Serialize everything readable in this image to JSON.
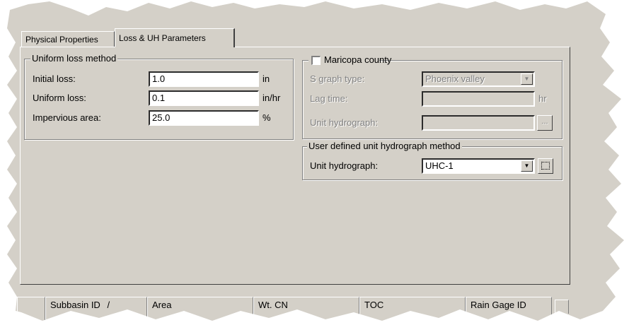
{
  "tabs": [
    {
      "label": "Physical Properties",
      "active": false
    },
    {
      "label": "Loss & UH Parameters",
      "active": true
    }
  ],
  "uniform_loss": {
    "title": "Uniform loss method",
    "fields": [
      {
        "label": "Initial loss:",
        "value": "1.0",
        "unit": "in"
      },
      {
        "label": "Uniform loss:",
        "value": "0.1",
        "unit": "in/hr"
      },
      {
        "label": "Impervious area:",
        "value": "25.0",
        "unit": "%"
      }
    ]
  },
  "maricopa": {
    "title": "Maricopa county",
    "checked": false,
    "s_graph_label": "S graph type:",
    "s_graph_value": "Phoenix valley",
    "lag_time_label": "Lag time:",
    "lag_time_value": "",
    "lag_time_unit": "hr",
    "unit_hydrograph_label": "Unit hydrograph:",
    "unit_hydrograph_value": "",
    "browse_label": "..."
  },
  "user_defined": {
    "title": "User defined unit hydrograph method",
    "unit_hydrograph_label": "Unit hydrograph:",
    "unit_hydrograph_value": "UHC-1"
  },
  "grid": {
    "columns": [
      {
        "label": ""
      },
      {
        "label": "Subbasin ID"
      },
      {
        "label": "Area"
      },
      {
        "label": "Wt. CN"
      },
      {
        "label": "TOC"
      },
      {
        "label": "Rain Gage ID"
      }
    ],
    "sort_indicator": "/"
  }
}
